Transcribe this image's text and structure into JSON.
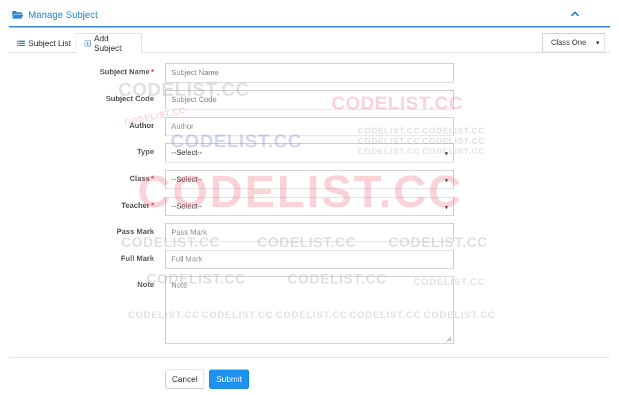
{
  "header": {
    "title": "Manage Subject",
    "icons": {
      "title": "folder-open-icon",
      "collapse": "chevron-up-icon"
    }
  },
  "tabs": [
    {
      "label": "Subject List",
      "icon": "list-icon",
      "active": false
    },
    {
      "label": "Add Subject",
      "icon": "plus-square-icon",
      "active": true
    }
  ],
  "class_filter": {
    "value": "Class One"
  },
  "form": {
    "subject_name": {
      "label": "Subject Name",
      "required": "*",
      "placeholder": "Subject Name"
    },
    "subject_code": {
      "label": "Subject Code",
      "placeholder": "Subject Code"
    },
    "author": {
      "label": "Author",
      "placeholder": "Author"
    },
    "type": {
      "label": "Type",
      "value": "--Select--"
    },
    "class": {
      "label": "Class",
      "required": "*",
      "value": "--Select--"
    },
    "teacher": {
      "label": "Teacher",
      "required": "*",
      "value": "--Select--"
    },
    "pass_mark": {
      "label": "Pass Mark",
      "placeholder": "Pass Mark"
    },
    "full_mark": {
      "label": "Full Mark",
      "placeholder": "Full Mark"
    },
    "note": {
      "label": "Note",
      "placeholder": "Note"
    }
  },
  "actions": {
    "cancel": "Cancel",
    "submit": "Submit"
  },
  "watermark": {
    "text": "CODELIST.CC"
  },
  "colors": {
    "accent": "#2d86d3",
    "submit": "#1e90f0",
    "required": "#cc3333"
  }
}
